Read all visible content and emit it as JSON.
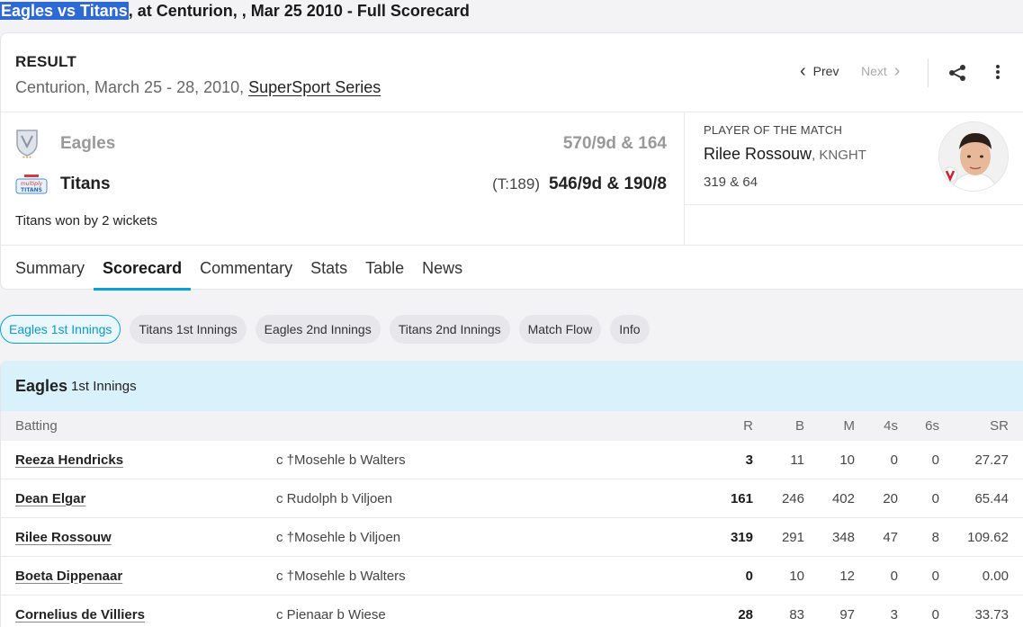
{
  "page_heading": {
    "selected": "Eagles vs Titans",
    "rest": ", at Centurion, , Mar 25 2010 - Full Scorecard"
  },
  "result": {
    "label": "RESULT",
    "venue_dates": "Centurion, March 25 - 28, 2010, ",
    "series": "SuperSport Series"
  },
  "nav": {
    "prev": "Prev",
    "next": "Next"
  },
  "teams": [
    {
      "name": "Eagles",
      "target": "",
      "score": "570/9d & 164",
      "dimmed": true
    },
    {
      "name": "Titans",
      "target": "(T:189)",
      "score": "546/9d & 190/8",
      "dimmed": false
    }
  ],
  "result_text": "Titans won by 2 wickets",
  "player_of_match": {
    "label": "Player Of The Match",
    "name": "Rilee Rossouw",
    "team": ", KNGHT",
    "stats": "319 & 64"
  },
  "tabs": [
    "Summary",
    "Scorecard",
    "Commentary",
    "Stats",
    "Table",
    "News"
  ],
  "innings_pills": [
    "Eagles 1st Innings",
    "Titans 1st Innings",
    "Eagles 2nd Innings",
    "Titans 2nd Innings",
    "Match Flow",
    "Info"
  ],
  "innings": {
    "team": "Eagles",
    "label": "1st Innings",
    "columns": {
      "batting": "Batting",
      "r": "R",
      "b": "B",
      "m": "M",
      "fours": "4s",
      "sixes": "6s",
      "sr": "SR"
    },
    "batters": [
      {
        "name": "Reeza Hendricks",
        "dismissal": "c †Mosehle b Walters",
        "r": "3",
        "b": "11",
        "m": "10",
        "fours": "0",
        "sixes": "0",
        "sr": "27.27"
      },
      {
        "name": "Dean Elgar",
        "dismissal": "c Rudolph b Viljoen",
        "r": "161",
        "b": "246",
        "m": "402",
        "fours": "20",
        "sixes": "0",
        "sr": "65.44"
      },
      {
        "name": "Rilee Rossouw",
        "dismissal": "c †Mosehle b Viljoen",
        "r": "319",
        "b": "291",
        "m": "348",
        "fours": "47",
        "sixes": "8",
        "sr": "109.62"
      },
      {
        "name": "Boeta Dippenaar",
        "dismissal": "c †Mosehle b Walters",
        "r": "0",
        "b": "10",
        "m": "12",
        "fours": "0",
        "sixes": "0",
        "sr": "0.00"
      },
      {
        "name": "Cornelius de Villiers",
        "dismissal": "c Pienaar b Wiese",
        "r": "28",
        "b": "83",
        "m": "97",
        "fours": "3",
        "sixes": "0",
        "sr": "33.73"
      }
    ]
  },
  "colors": {
    "accent": "#0aa0d5",
    "innings_header_bg": "#d9f1fb",
    "selection": "#2d6ad6"
  }
}
